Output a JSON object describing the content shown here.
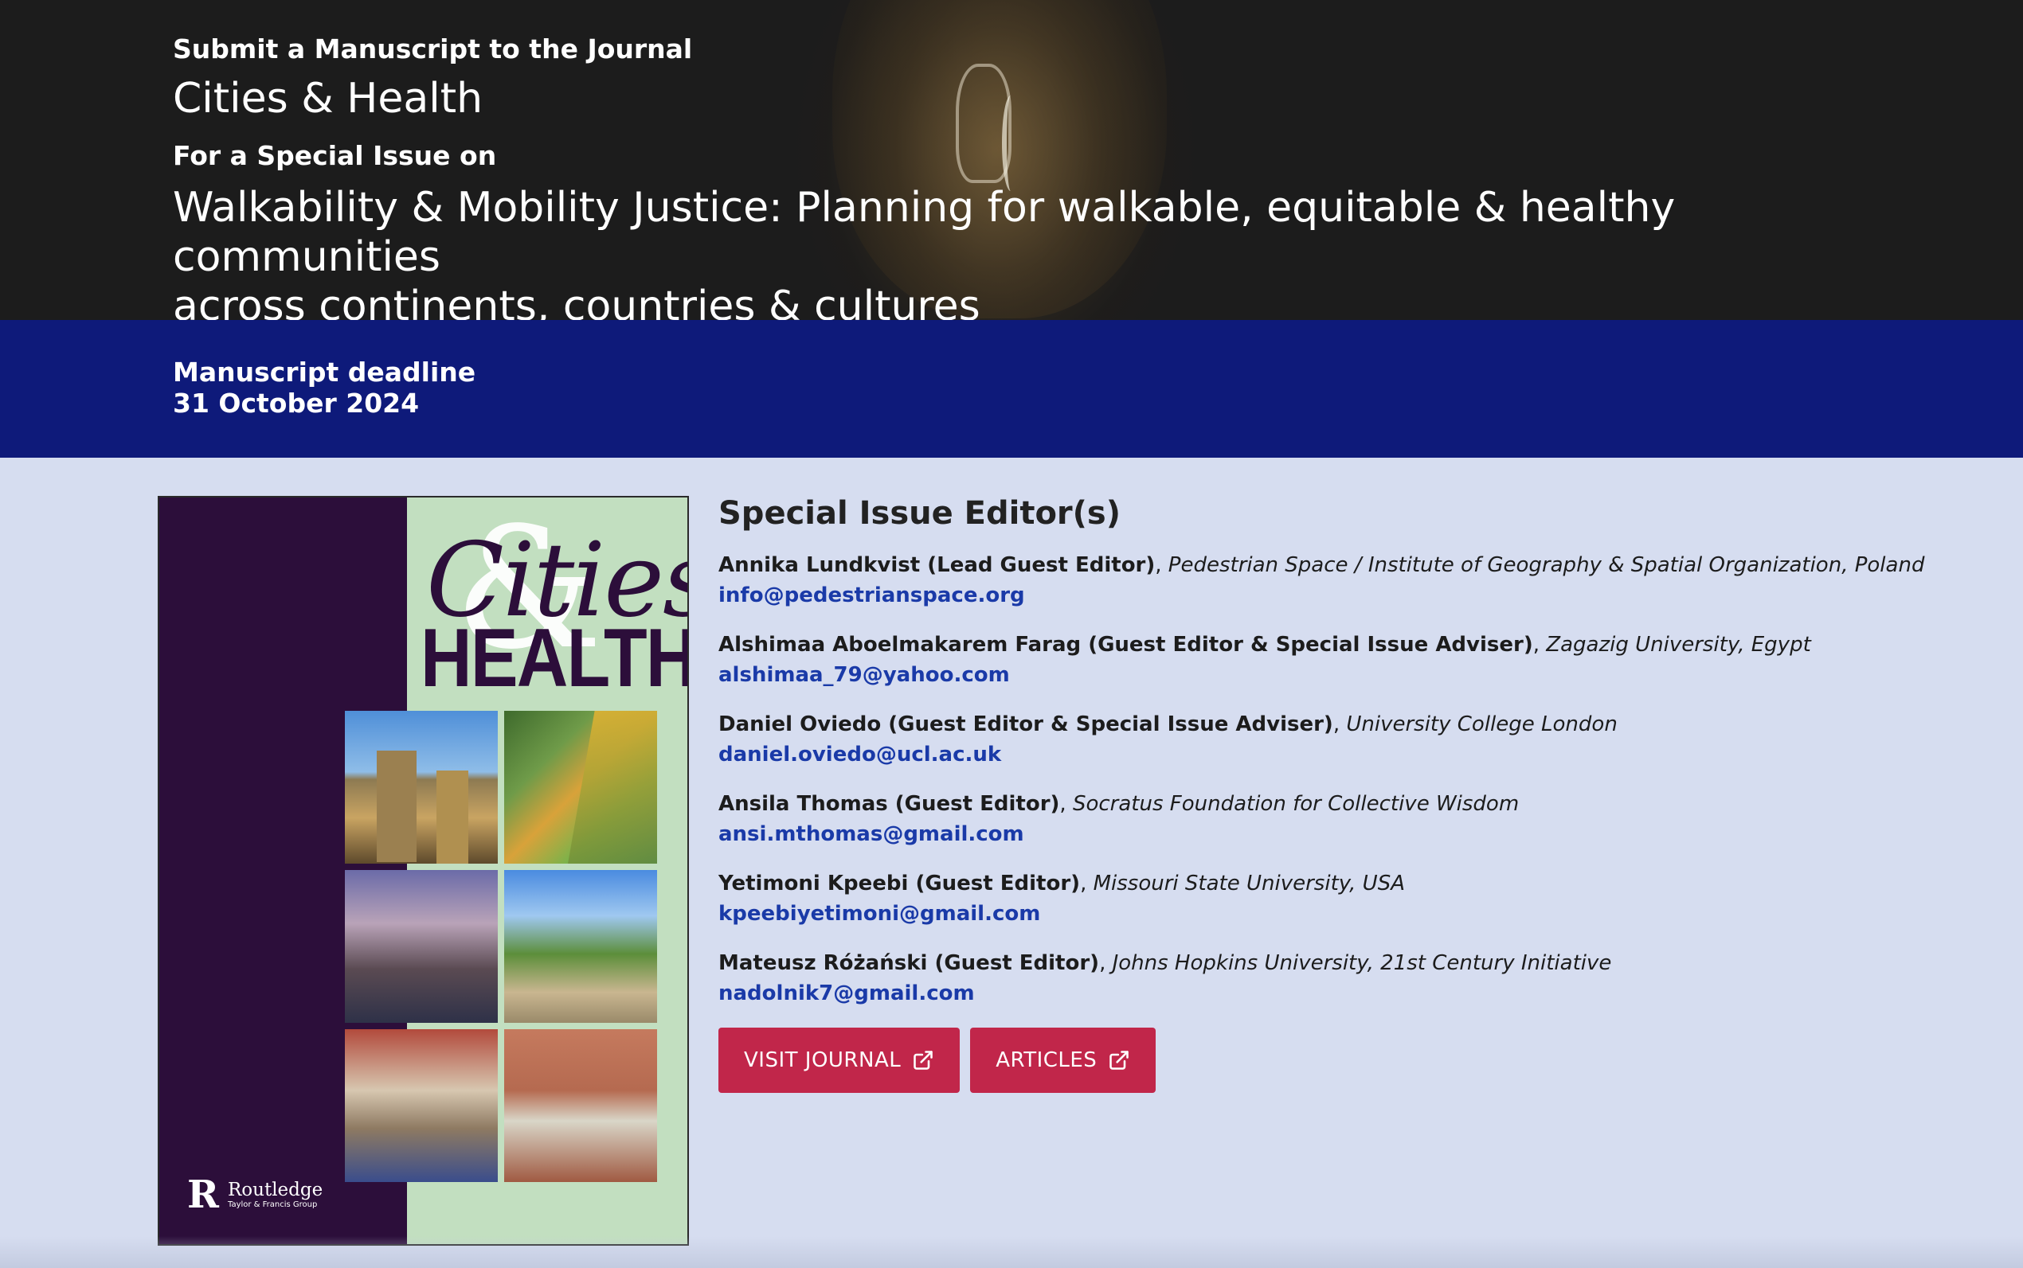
{
  "hero": {
    "kicker": "Submit a Manuscript to the Journal",
    "journal_name": "Cities & Health",
    "kicker2": "For a Special Issue on",
    "issue_title_line1": "Walkability & Mobility Justice: Planning for walkable, equitable & healthy communities",
    "issue_title_line2": "across continents, countries & cultures"
  },
  "deadline": {
    "label": "Manuscript deadline",
    "date": "31 October 2024"
  },
  "cover": {
    "title_script": "Cities",
    "title_amp": "&",
    "title_bold": "HEALTH",
    "publisher": "Routledge",
    "publisher_sub": "Taylor & Francis Group",
    "accent_dark": "#2c0e3a",
    "accent_light": "#c2dfc0"
  },
  "editors": {
    "heading": "Special Issue Editor(s)",
    "items": [
      {
        "name": "Annika Lundkvist (Lead Guest Editor)",
        "affiliation": "Pedestrian Space / Institute of Geography & Spatial Organization, Poland",
        "email": "info@pedestrianspace.org"
      },
      {
        "name": "Alshimaa Aboelmakarem Farag (Guest Editor & Special Issue Adviser)",
        "affiliation": "Zagazig University, Egypt",
        "email": "alshimaa_79@yahoo.com"
      },
      {
        "name": "Daniel Oviedo (Guest Editor & Special Issue Adviser)",
        "affiliation": "University College London",
        "email": "daniel.oviedo@ucl.ac.uk"
      },
      {
        "name": "Ansila Thomas (Guest Editor)",
        "affiliation": "Socratus Foundation for Collective Wisdom",
        "email": "ansi.mthomas@gmail.com"
      },
      {
        "name": "Yetimoni Kpeebi (Guest Editor)",
        "affiliation": "Missouri State University, USA",
        "email": "kpeebiyetimoni@gmail.com"
      },
      {
        "name": "Mateusz Różański (Guest Editor)",
        "affiliation": "Johns Hopkins University, 21st Century Initiative",
        "email": "nadolnik7@gmail.com"
      }
    ]
  },
  "buttons": {
    "visit_journal": "VISIT JOURNAL",
    "articles": "ARTICLES"
  },
  "colors": {
    "hero_bg": "#1c1c1c",
    "deadline_bg": "#0e1a7a",
    "content_bg": "#d6ddf0",
    "button_bg": "#c1264a",
    "link": "#1a3aa8"
  }
}
